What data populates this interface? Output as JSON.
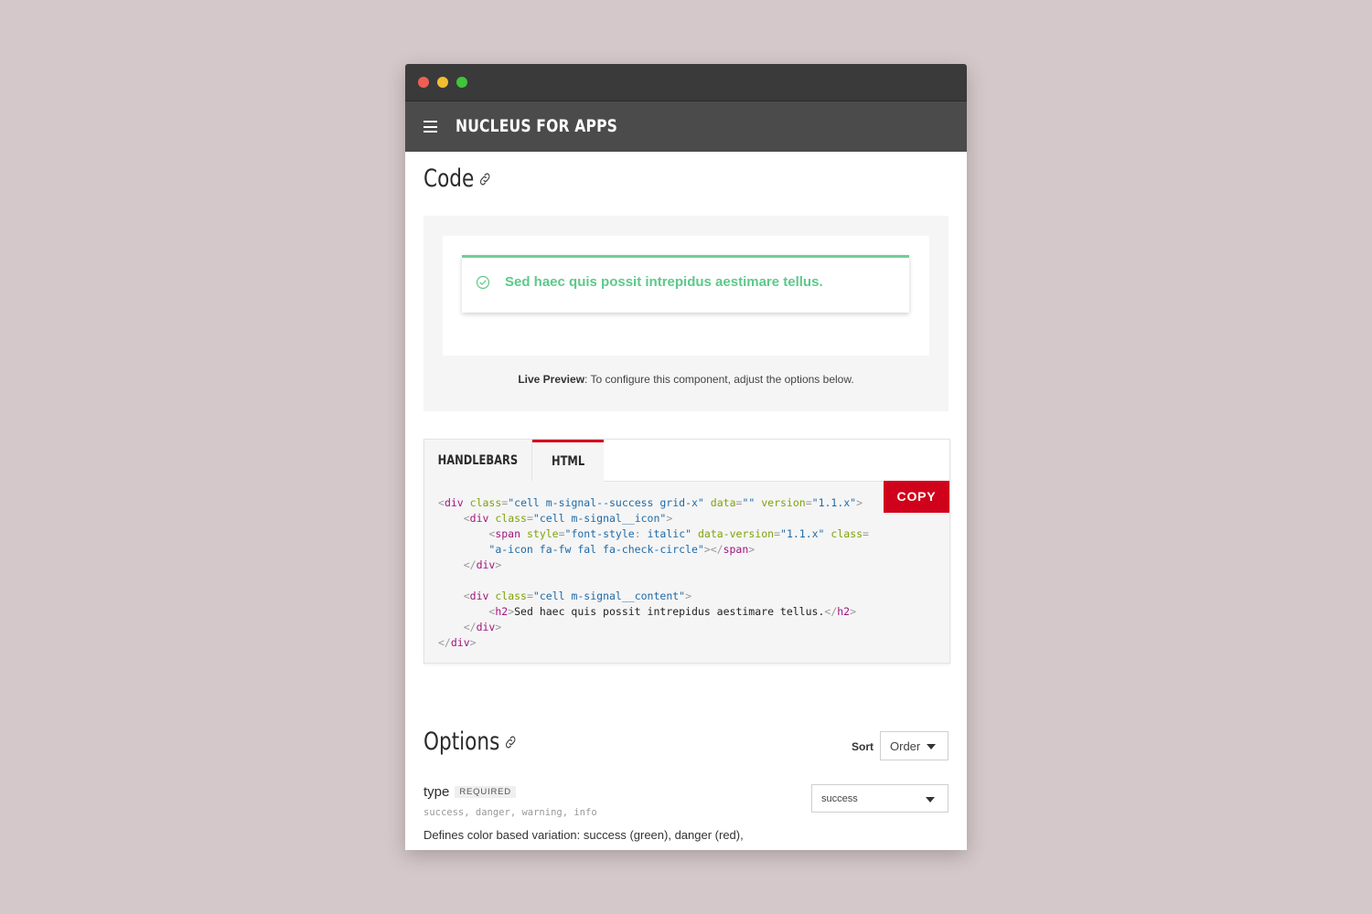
{
  "window": {
    "controls": [
      "close",
      "minimize",
      "maximize"
    ]
  },
  "appbar": {
    "title": "NUCLEUS FOR APPS",
    "menu_icon": "hamburger-icon"
  },
  "code_section": {
    "heading": "Code",
    "preview": {
      "signal_text": "Sed haec quis possit intrepidus aestimare tellus.",
      "signal_icon": "check-circle-icon",
      "signal_color": "#5dc98a",
      "live_label": "Live Preview",
      "live_text": ": To configure this component, adjust the options below."
    },
    "tabs": [
      {
        "label": "HANDLEBARS",
        "active": false
      },
      {
        "label": "HTML",
        "active": true
      }
    ],
    "copy_label": "COPY",
    "accent_color": "#d0021b"
  },
  "options_section": {
    "heading": "Options",
    "sort_label": "Sort",
    "sort_value": "Order",
    "option": {
      "name": "type",
      "badge": "REQUIRED",
      "values": "success, danger, warning, info",
      "description": "Defines color based variation: success (green), danger (red),",
      "selected": "success"
    }
  }
}
